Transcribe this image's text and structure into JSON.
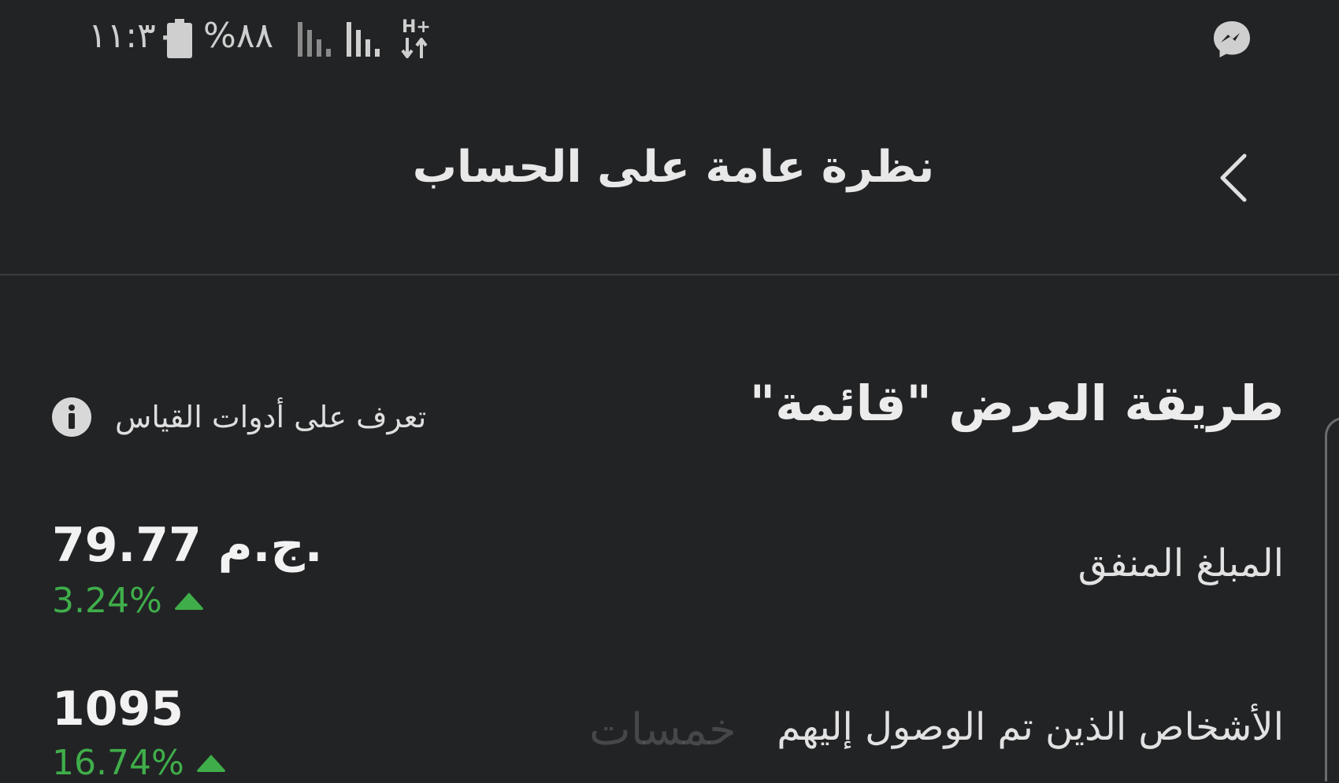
{
  "status_bar": {
    "time": "١١:٣٠",
    "battery_percent": "%٨٨",
    "network_type": "H+",
    "icons": [
      "battery-icon",
      "signal-icon",
      "signal-icon",
      "network-arrows-icon",
      "messenger-icon"
    ]
  },
  "header": {
    "title": "نظرة عامة على الحساب",
    "back_icon": "chevron-left-icon"
  },
  "section": {
    "title": "طريقة العرض \"قائمة\"",
    "learn_link": "تعرف على أدوات القياس",
    "info_icon": "info-icon"
  },
  "metrics": [
    {
      "label": "المبلغ المنفق",
      "value": "79.77 ج.م.",
      "change": "3.24%",
      "trend": "up"
    },
    {
      "label": "الأشخاص الذين تم الوصول إليهم",
      "value": "1095",
      "change": "16.74%",
      "trend": "up"
    }
  ],
  "watermark": "خمسات",
  "colors": {
    "background": "#222325",
    "positive": "#3fae4a",
    "text": "#e6e6e6"
  }
}
